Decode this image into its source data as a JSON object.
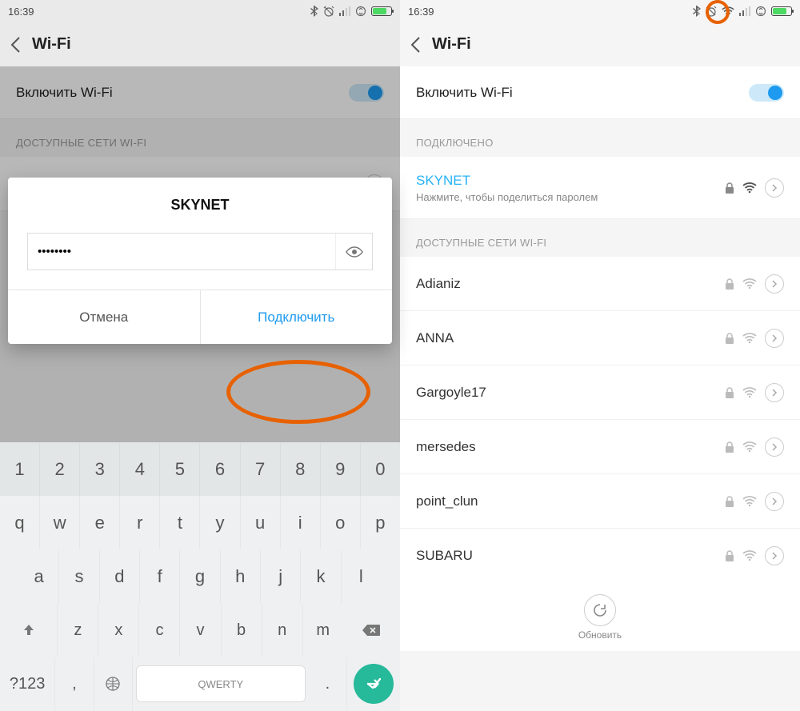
{
  "time": "16:39",
  "header_title": "Wi-Fi",
  "enable_wifi": "Включить Wi-Fi",
  "section_available": "ДОСТУПНЫЕ СЕТИ WI-FI",
  "section_connected": "ПОДКЛЮЧЕНО",
  "left": {
    "visible_network": "Adianiz",
    "dialog": {
      "title": "SKYNET",
      "password": "••••••••",
      "cancel": "Отмена",
      "connect": "Подключить"
    },
    "keyboard": {
      "nums": [
        "1",
        "2",
        "3",
        "4",
        "5",
        "6",
        "7",
        "8",
        "9",
        "0"
      ],
      "r2": [
        "q",
        "w",
        "e",
        "r",
        "t",
        "y",
        "u",
        "i",
        "o",
        "p"
      ],
      "r3": [
        "a",
        "s",
        "d",
        "f",
        "g",
        "h",
        "j",
        "k",
        "l"
      ],
      "r4": [
        "z",
        "x",
        "c",
        "v",
        "b",
        "n",
        "m"
      ],
      "symkey": "?123",
      "comma": ",",
      "dot": ".",
      "layout": "QWERTY"
    }
  },
  "right": {
    "connected": {
      "name": "SKYNET",
      "hint": "Нажмите, чтобы поделиться паролем"
    },
    "networks": [
      "Adianiz",
      "ANNA",
      "Gargoyle17",
      "mersedes",
      "point_clun",
      "SUBARU"
    ],
    "refresh": "Обновить"
  }
}
